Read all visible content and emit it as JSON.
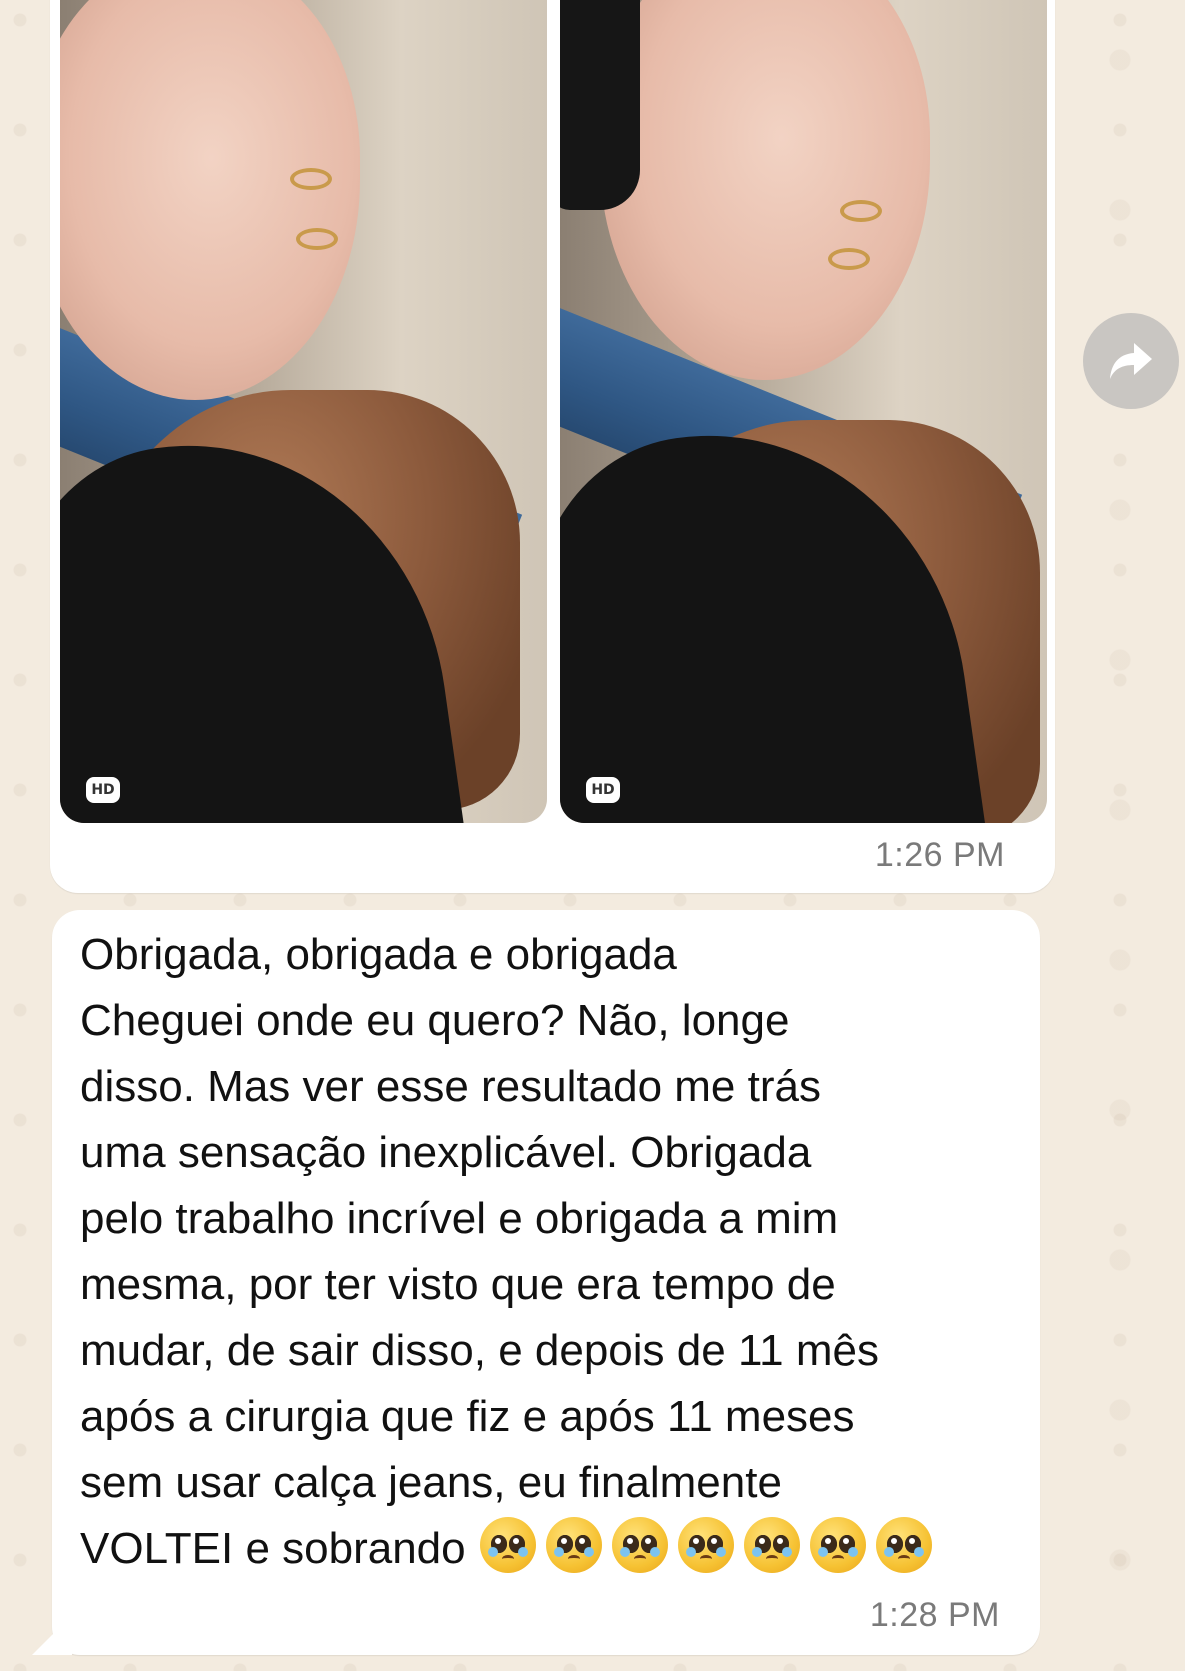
{
  "colors": {
    "wallpaper": "#f3ebdf",
    "bubble": "#ffffff",
    "timestamp": "#7a7a7a",
    "forward_button": "#c9c6c2"
  },
  "media_message": {
    "photos": [
      {
        "badge": "HD",
        "icon": "hd-badge"
      },
      {
        "badge": "HD",
        "icon": "hd-badge"
      }
    ],
    "time": "1:26 PM"
  },
  "forward": {
    "icon": "forward-arrow-icon"
  },
  "text_message": {
    "text": "Obrigada, obrigada e obrigada\nCheguei onde eu quero? Não, longe\ndisso. Mas ver esse resultado me trás\numa sensação inexplicável. Obrigada\npelo trabalho incrível e obrigada a mim\nmesma, por ter visto que era tempo de\nmudar, de sair disso, e depois de 11 mês\napós a cirurgia que fiz e após 11 meses\nsem usar calça jeans, eu finalmente\nVOLTEI e sobrando",
    "emoji_name": "pleading-face-emoji",
    "emoji_count": 7,
    "time": "1:28 PM"
  }
}
